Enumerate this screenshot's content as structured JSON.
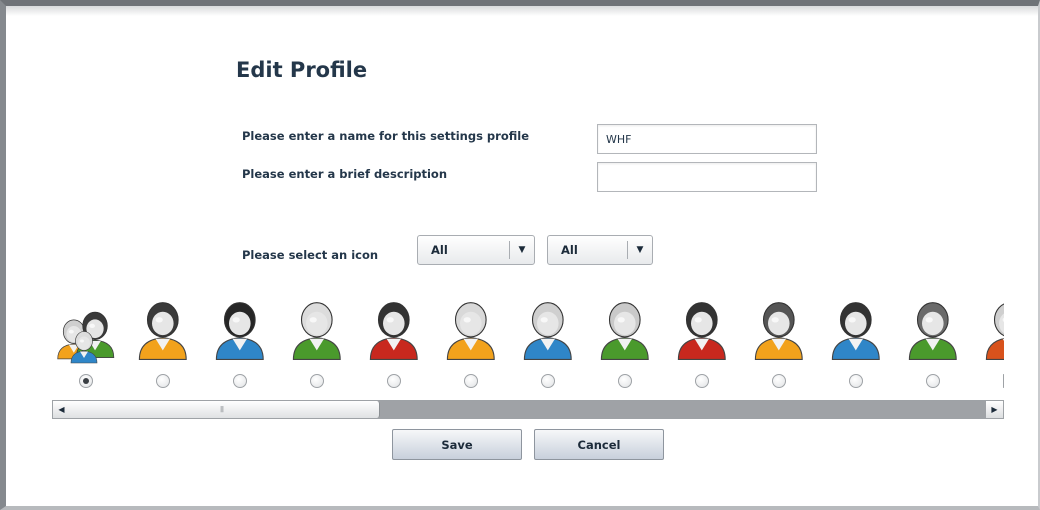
{
  "page": {
    "title": "Edit Profile"
  },
  "form": {
    "name_label": "Please enter a name for this settings profile",
    "name_value": "WHF",
    "description_label": "Please enter a brief description",
    "description_value": "",
    "icon_label": "Please select an icon",
    "filter1": "All",
    "filter2": "All"
  },
  "icons": [
    {
      "name": "family-icon",
      "kind": "family",
      "selected": true
    },
    {
      "name": "woman-orange-icon",
      "hair": "#3a3a3a",
      "shirt": "#f2a21c",
      "selected": false
    },
    {
      "name": "woman-blue-icon",
      "hair": "#262626",
      "shirt": "#2f86c8",
      "selected": false
    },
    {
      "name": "woman-green-icon",
      "hair": "#dcdcdc",
      "shirt": "#4a9a2c",
      "selected": false
    },
    {
      "name": "woman-red-icon",
      "hair": "#333333",
      "shirt": "#c8281e",
      "selected": false
    },
    {
      "name": "woman-orange-blonde-icon",
      "hair": "#d9d9d9",
      "shirt": "#f2a21c",
      "selected": false
    },
    {
      "name": "woman-blue-grey-icon",
      "hair": "#cfcfcf",
      "shirt": "#2f86c8",
      "selected": false
    },
    {
      "name": "man-green-icon",
      "hair": "#c9c9c9",
      "shirt": "#4a9a2c",
      "selected": false
    },
    {
      "name": "man-red-icon",
      "hair": "#333333",
      "shirt": "#c8281e",
      "selected": false
    },
    {
      "name": "man-orange-beard-icon",
      "hair": "#555555",
      "shirt": "#f2a21c",
      "selected": false
    },
    {
      "name": "man-blue-icon",
      "hair": "#333333",
      "shirt": "#2f86c8",
      "selected": false
    },
    {
      "name": "man-green-dark-icon",
      "hair": "#6a6a6a",
      "shirt": "#4a9a2c",
      "selected": false
    },
    {
      "name": "man-red-partial-icon",
      "hair": "#cfcfcf",
      "shirt": "#d8521c",
      "selected": false
    }
  ],
  "buttons": {
    "save": "Save",
    "cancel": "Cancel"
  },
  "scrollbar": {
    "position": 0.0
  }
}
